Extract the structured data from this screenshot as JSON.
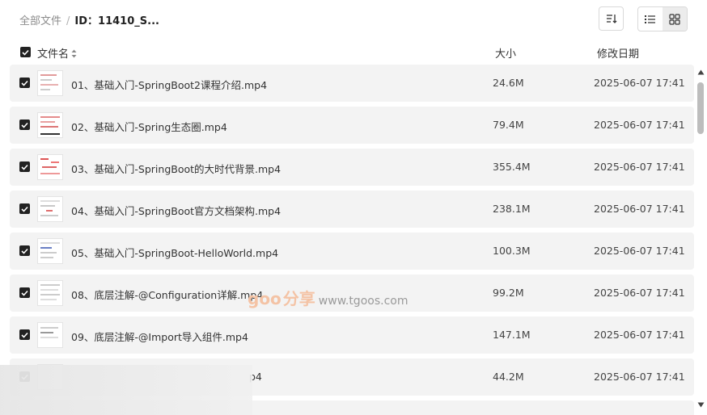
{
  "breadcrumb": {
    "root": "全部文件",
    "separator": "/",
    "current": "ID：11410_S..."
  },
  "toolbar": {
    "sort_icon": "sort-icon",
    "list_view_icon": "list-view-icon",
    "grid_view_icon": "grid-view-icon"
  },
  "columns": {
    "name": "文件名",
    "size": "大小",
    "date": "修改日期"
  },
  "files": [
    {
      "name": "01、基础入门-SpringBoot2课程介绍.mp4",
      "size": "24.6M",
      "date": "2025-06-07 17:41"
    },
    {
      "name": "02、基础入门-Spring生态圈.mp4",
      "size": "79.4M",
      "date": "2025-06-07 17:41"
    },
    {
      "name": "03、基础入门-SpringBoot的大时代背景.mp4",
      "size": "355.4M",
      "date": "2025-06-07 17:41"
    },
    {
      "name": "04、基础入门-SpringBoot官方文档架构.mp4",
      "size": "238.1M",
      "date": "2025-06-07 17:41"
    },
    {
      "name": "05、基础入门-SpringBoot-HelloWorld.mp4",
      "size": "100.3M",
      "date": "2025-06-07 17:41"
    },
    {
      "name": "08、底层注解-@Configuration详解.mp4",
      "size": "99.2M",
      "date": "2025-06-07 17:41"
    },
    {
      "name": "09、底层注解-@Import导入组件.mp4",
      "size": "147.1M",
      "date": "2025-06-07 17:41"
    },
    {
      "name": "p4",
      "size": "44.2M",
      "date": "2025-06-07 17:41"
    }
  ],
  "watermark": {
    "brand": "goo",
    "cn": "分享",
    "url": "www.tgoos.com"
  },
  "colors": {
    "row_bg": "#f3f3f3",
    "checkbox": "#222222",
    "watermark": "#f4c3a5"
  }
}
